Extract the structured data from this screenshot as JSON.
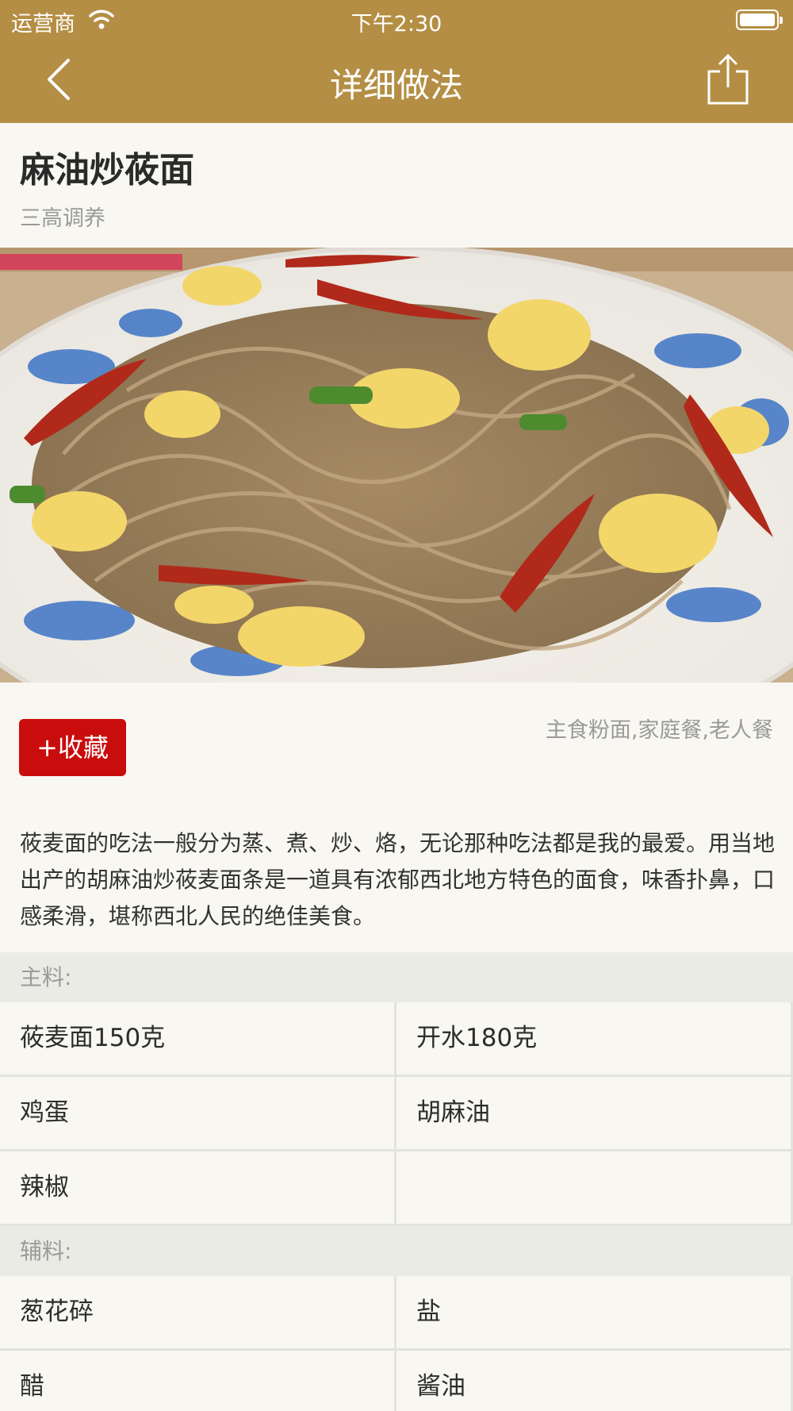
{
  "status_bar": {
    "carrier": "运营商",
    "time": "下午2:30"
  },
  "nav": {
    "title": "详细做法"
  },
  "dish": {
    "title": "麻油炒莜面",
    "subtitle": "三高调养"
  },
  "actions": {
    "favorite_label": "+收藏"
  },
  "tags": "主食粉面,家庭餐,老人餐",
  "description": "莜麦面的吃法一般分为蒸、煮、炒、烙，无论那种吃法都是我的最爱。用当地出产的胡麻油炒莜麦面条是一道具有浓郁西北地方特色的面食，味香扑鼻，口感柔滑，堪称西北人民的绝佳美食。",
  "main_ingredients": {
    "header": "主料:",
    "rows": [
      [
        "莜麦面150克",
        "开水180克"
      ],
      [
        "鸡蛋",
        "胡麻油"
      ],
      [
        "辣椒",
        ""
      ]
    ]
  },
  "aux_ingredients": {
    "header": "辅料:",
    "rows": [
      [
        "葱花碎",
        "盐"
      ],
      [
        "醋",
        "酱油"
      ]
    ]
  },
  "colors": {
    "nav_bg": "#b48e44",
    "favorite_bg": "#c90c0c",
    "page_bg": "#f8f7f1"
  }
}
